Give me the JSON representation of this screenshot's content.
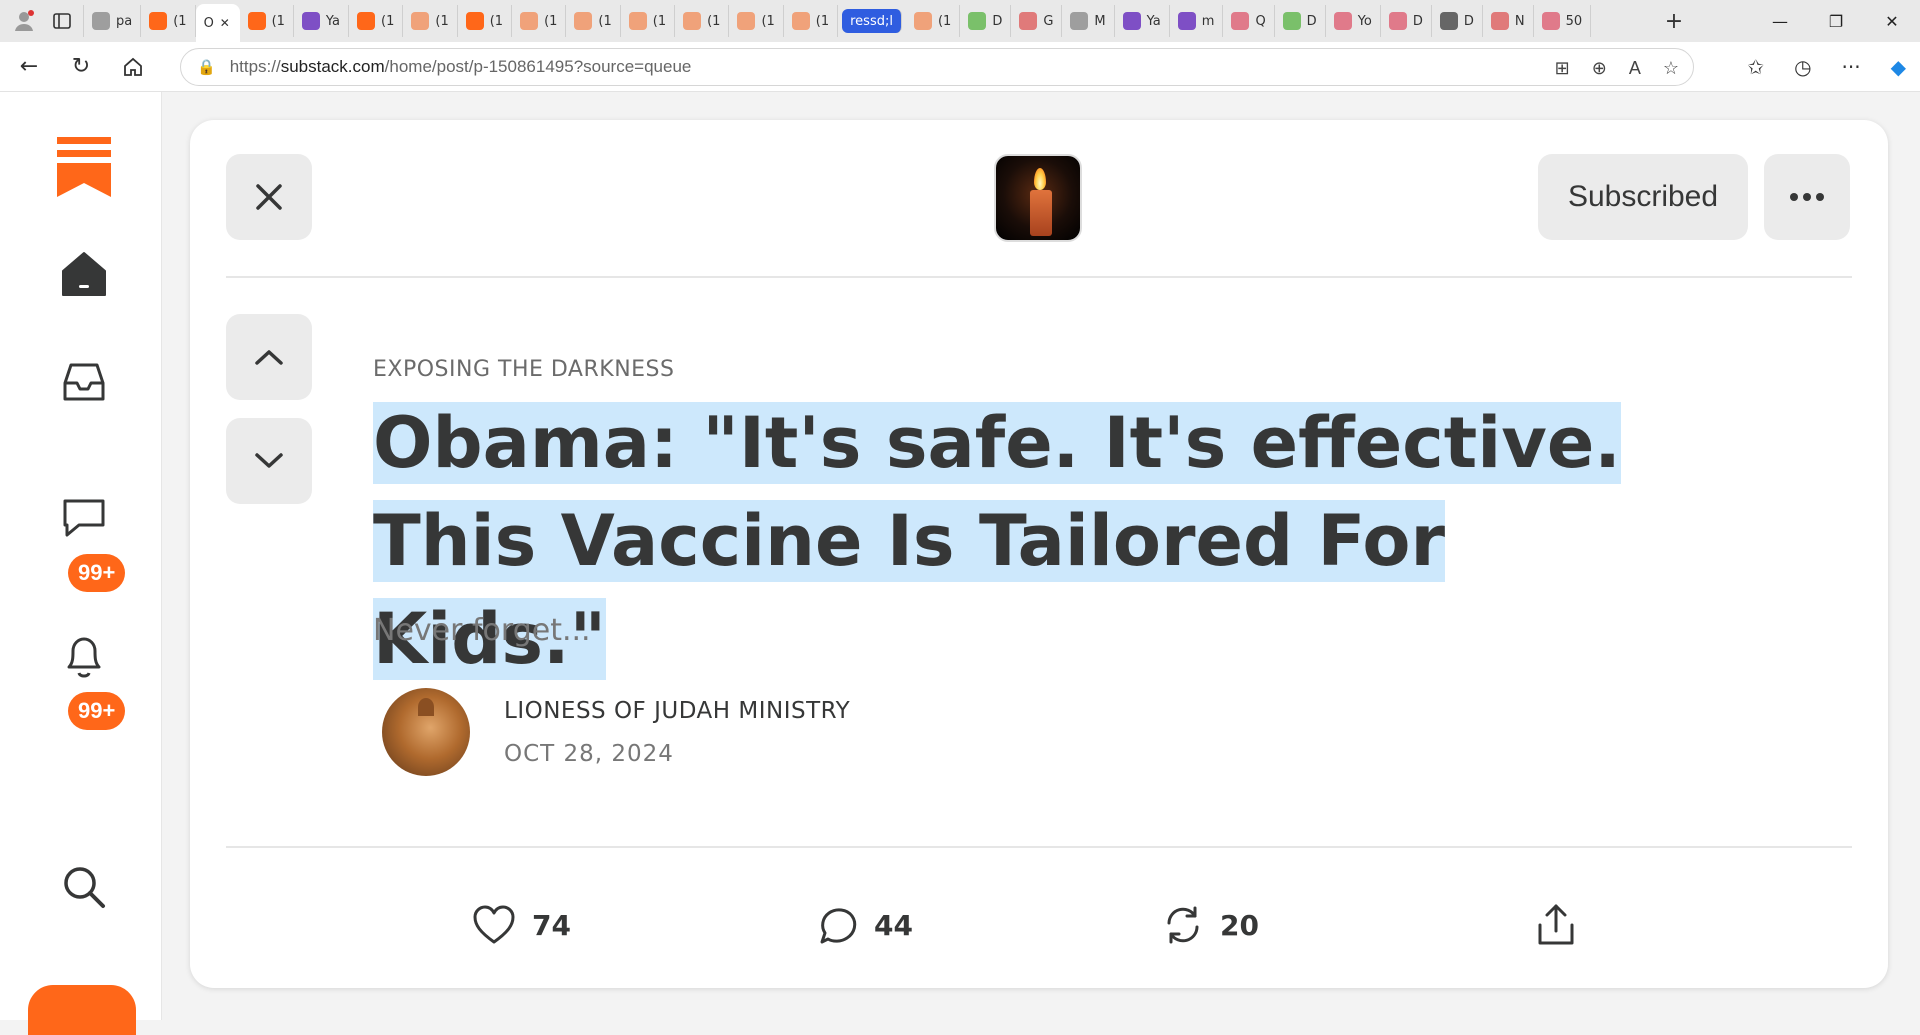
{
  "browser": {
    "tabs": [
      {
        "label": "pa",
        "favicon": "file-icon",
        "color": "#9e9e9e"
      },
      {
        "label": "(1",
        "favicon": "substack-icon",
        "color": "#ff6719"
      },
      {
        "label": "O",
        "favicon": "",
        "color": "#ffffff",
        "active": true
      },
      {
        "label": "(1",
        "favicon": "substack-icon",
        "color": "#ff6719"
      },
      {
        "label": "Ya",
        "favicon": "yahoo-icon",
        "color": "#7e4fc5"
      },
      {
        "label": "(1",
        "favicon": "substack-icon",
        "color": "#ff6719"
      },
      {
        "label": "(1",
        "favicon": "substack-icon",
        "color": "#f0a27a"
      },
      {
        "label": "(1",
        "favicon": "substack-icon",
        "color": "#ff6719"
      },
      {
        "label": "(1",
        "favicon": "substack-icon",
        "color": "#f0a27a"
      },
      {
        "label": "(1",
        "favicon": "substack-icon",
        "color": "#f0a27a"
      },
      {
        "label": "(1",
        "favicon": "substack-icon",
        "color": "#f0a27a"
      },
      {
        "label": "(1",
        "favicon": "substack-icon",
        "color": "#f0a27a"
      },
      {
        "label": "(1",
        "favicon": "substack-icon",
        "color": "#f0a27a"
      },
      {
        "label": "(1",
        "favicon": "substack-icon",
        "color": "#f0a27a"
      },
      {
        "label": "ressd;l",
        "favicon": "",
        "color": "#2f5de0",
        "highlight": true
      },
      {
        "label": "(1",
        "favicon": "substack-icon",
        "color": "#f0a27a"
      },
      {
        "label": "D",
        "favicon": "play-icon",
        "color": "#7ac06a"
      },
      {
        "label": "G",
        "favicon": "mic-icon",
        "color": "#e07a7a"
      },
      {
        "label": "M",
        "favicon": "search-icon",
        "color": "#9e9e9e"
      },
      {
        "label": "Ya",
        "favicon": "yahoo-icon",
        "color": "#7e4fc5"
      },
      {
        "label": "m",
        "favicon": "yahoo-icon",
        "color": "#7e4fc5"
      },
      {
        "label": "Q",
        "favicon": "youtube-icon",
        "color": "#e07a8a"
      },
      {
        "label": "D",
        "favicon": "play-icon",
        "color": "#7ac06a"
      },
      {
        "label": "Yo",
        "favicon": "youtube-icon",
        "color": "#e07a8a"
      },
      {
        "label": "D",
        "favicon": "youtube-icon",
        "color": "#e07a8a"
      },
      {
        "label": "D",
        "favicon": "slash-icon",
        "color": "#666666"
      },
      {
        "label": "N",
        "favicon": "flag-icon",
        "color": "#e07a7a"
      },
      {
        "label": "50",
        "favicon": "youtube-icon",
        "color": "#e07a8a"
      }
    ],
    "url_prefix": "https://",
    "url_host": "substack.com",
    "url_path": "/home/post/p-150861495?source=queue"
  },
  "sidebar": {
    "badges": [
      "99+",
      "99+"
    ],
    "accent": "#ff6719"
  },
  "post": {
    "subscribe_label": "Subscribed",
    "section": "EXPOSING THE DARKNESS",
    "title_line1": "Obama: \"It's safe. It's effective.",
    "title_line2": "This Vaccine Is Tailored For Kids.\"",
    "subtitle": "Never forget...",
    "author": "LIONESS OF JUDAH MINISTRY",
    "date": "OCT 28, 2024",
    "likes": "74",
    "comments": "44",
    "restacks": "20"
  }
}
